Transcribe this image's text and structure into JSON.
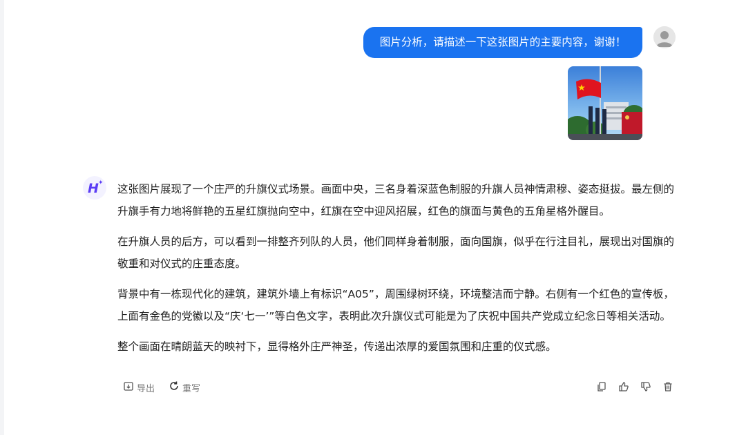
{
  "user": {
    "message": "图片分析，请描述一下这张图片的主要内容，谢谢！",
    "avatar_icon": "user-avatar-icon",
    "bubble_color": "#1a73f0"
  },
  "assistant": {
    "avatar_letter": "H",
    "avatar_star": "✦",
    "avatar_color": "#5b3df5",
    "paragraphs": [
      "这张图片展现了一个庄严的升旗仪式场景。画面中央，三名身着深蓝色制服的升旗人员神情肃穆、姿态挺拔。最左侧的升旗手有力地将鲜艳的五星红旗抛向空中，红旗在空中迎风招展，红色的旗面与黄色的五角星格外醒目。",
      "在升旗人员的后方，可以看到一排整齐列队的人员，他们同样身着制服，面向国旗，似乎在行注目礼，展现出对国旗的敬重和对仪式的庄重态度。",
      "背景中有一栋现代化的建筑，建筑外墙上有标识“A05”，周围绿树环绕，环境整洁而宁静。右侧有一个红色的宣传板，上面有金色的党徽以及“庆‘七一’”等白色文字，表明此次升旗仪式可能是为了庆祝中国共产党成立纪念日等相关活动。",
      "整个画面在晴朗蓝天的映衬下，显得格外庄严神圣，传递出浓厚的爱国氛围和庄重的仪式感。"
    ]
  },
  "actions": {
    "export_label": "导出",
    "regenerate_label": "重写",
    "right_icons": [
      "copy-icon",
      "thumbs-up-icon",
      "thumbs-down-icon",
      "trash-icon"
    ]
  }
}
